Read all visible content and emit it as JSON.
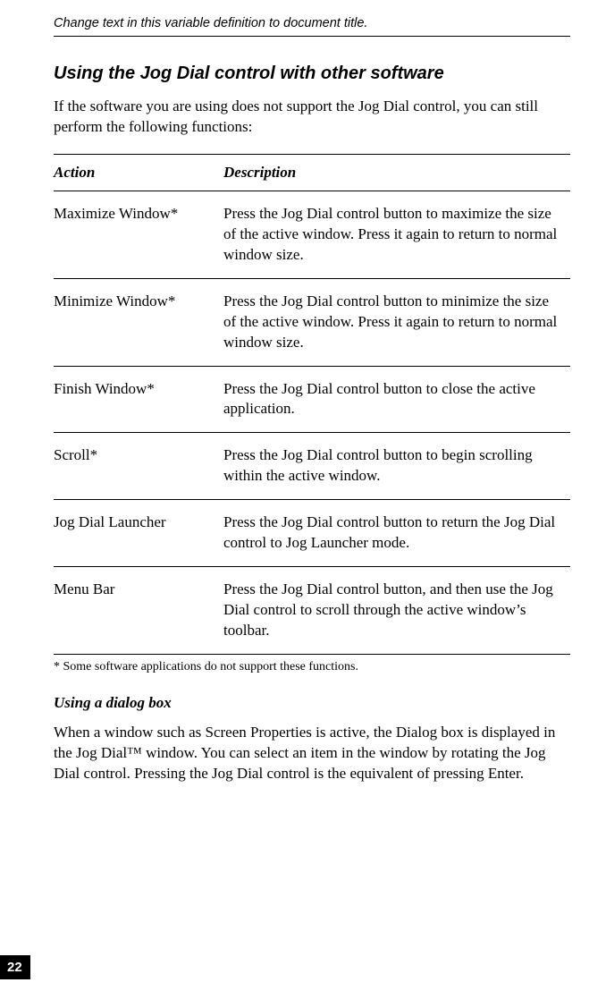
{
  "runningHeader": "Change text in this variable definition to document title.",
  "sectionTitle": "Using the Jog Dial control with other software",
  "intro": "If the software you are using does not support the Jog Dial control, you can still perform the following functions:",
  "table": {
    "headers": {
      "action": "Action",
      "description": "Description"
    },
    "rows": [
      {
        "action": "Maximize Window*",
        "description": "Press the Jog Dial control button to maximize the size of the active window. Press it again to return to normal window size."
      },
      {
        "action": "Minimize Window*",
        "description": "Press the Jog Dial control button to minimize the size of the active window. Press it again to return to normal window size."
      },
      {
        "action": "Finish Window*",
        "description": "Press the Jog Dial control button to close the active application."
      },
      {
        "action": "Scroll*",
        "description": "Press the Jog Dial control button to begin scrolling within the active window."
      },
      {
        "action": "Jog Dial Launcher",
        "description": "Press the Jog Dial control button to return the Jog Dial control to Jog Launcher mode."
      },
      {
        "action": "Menu Bar",
        "description": "Press the Jog Dial control button, and then use the Jog Dial control to scroll through the active window’s toolbar."
      }
    ]
  },
  "footnote": "*  Some software applications do not support these functions.",
  "subSectionTitle": "Using a dialog box",
  "subSectionBody": "When a window such as Screen Properties is active, the Dialog box is displayed in the Jog Dial™ window. You can select an item in the window by rotating the Jog Dial control. Pressing the Jog Dial control is the equivalent of pressing Enter.",
  "pageNumber": "22"
}
